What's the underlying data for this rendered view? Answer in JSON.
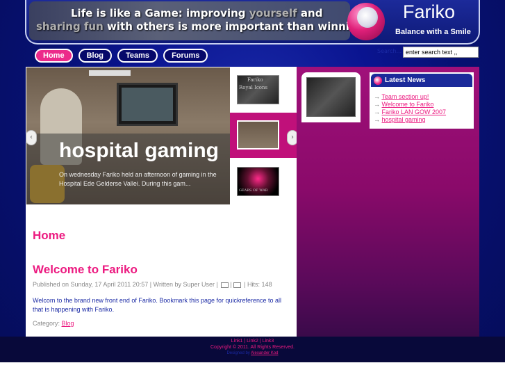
{
  "header": {
    "slogan_line1_a": "Life is like a Game: ",
    "slogan_line1_b": "improving ",
    "slogan_line1_c": "yourself",
    "slogan_line1_d": " and",
    "slogan_line2_a": "sharing fun",
    "slogan_line2_b": " with others is more important than winning.",
    "site_title": "Fariko",
    "tagline": "Balance with a Smile"
  },
  "nav": {
    "items": [
      {
        "label": "Home",
        "active": true
      },
      {
        "label": "Blog",
        "active": false
      },
      {
        "label": "Teams",
        "active": false
      },
      {
        "label": "Forums",
        "active": false
      }
    ]
  },
  "search": {
    "label": "Search...",
    "value": "enter search text ,,"
  },
  "slideshow": {
    "title": "hospital gaming",
    "description": "On wednesday Fariko held an afternoon of gaming in the Hospital Ede Gelderse Vallei. During this gam...",
    "prev_icon": "‹",
    "next_icon": "›",
    "thumb1_text_a": "Fariko",
    "thumb1_text_b": "Royal Icons",
    "thumb3_text": "GEARS OF WAR"
  },
  "content": {
    "page_heading": "Home",
    "article_title": "Welcome to Fariko",
    "meta": "Published on Sunday, 17 April 2011 20:57 | Written by Super User |",
    "hits": "| Hits: 148",
    "body": "Welcom to the brand new front end of Fariko. Bookmark this page for quickreference to all that is happening with Fariko.",
    "category_label": "Category: ",
    "category_link": "Blog"
  },
  "latest_news": {
    "title": "Latest News",
    "items": [
      "Team section up!",
      "Welcome to Fariko",
      "Fariko LAN GOW 2007",
      "hospital gaming"
    ]
  },
  "footer": {
    "link1": "Link1",
    "link2": "Link2",
    "link3": "Link3",
    "sep": " | ",
    "copyright": "Copyright © 2011. All Rights Reserved.",
    "designed_by": "Designed by ",
    "designer": "Alexander Kod"
  }
}
